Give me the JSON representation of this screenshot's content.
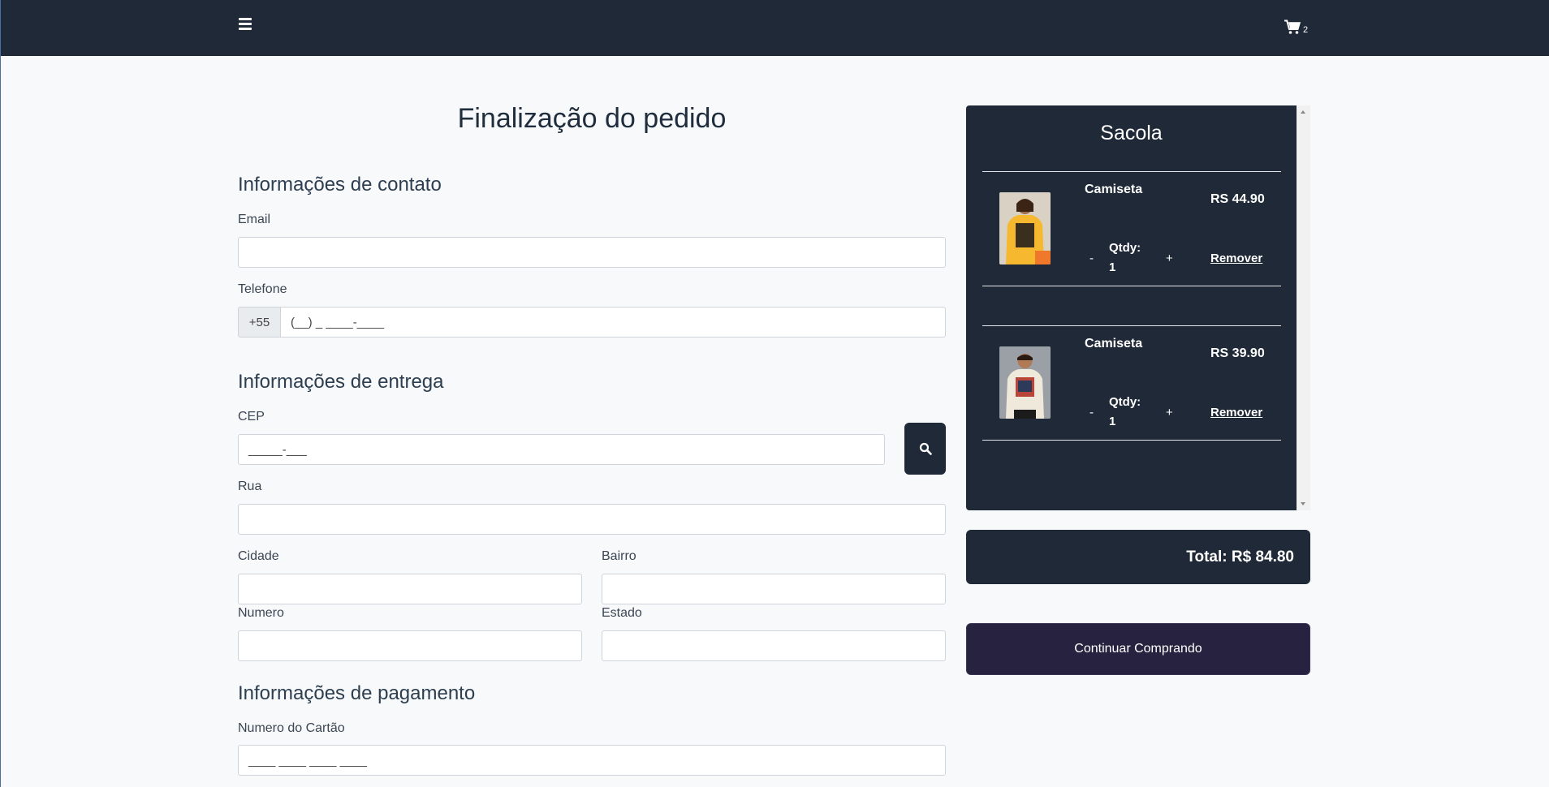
{
  "header": {
    "menu_icon": "hamburger-icon",
    "cart_icon": "cart-icon",
    "cart_count": "2"
  },
  "page": {
    "title": "Finalização do pedido"
  },
  "contact": {
    "title": "Informações de contato",
    "email_label": "Email",
    "email_value": "",
    "phone_label": "Telefone",
    "phone_prefix": "+55",
    "phone_mask": "(__) _ ____-____"
  },
  "delivery": {
    "title": "Informações de entrega",
    "cep_label": "CEP",
    "cep_mask": "_____-___",
    "search_icon": "search-icon",
    "street_label": "Rua",
    "city_label": "Cidade",
    "district_label": "Bairro",
    "number_label": "Numero",
    "state_label": "Estado"
  },
  "payment": {
    "title": "Informações de pagamento",
    "card_label": "Numero do Cartão",
    "card_mask": "____ ____ ____ ____"
  },
  "bag": {
    "title": "Sacola",
    "items": [
      {
        "name": "Camiseta",
        "price": "RS 44.90",
        "minus": "-",
        "plus": "+",
        "qty": "Qtdy: 1",
        "remove": "Remover",
        "shirt_color": "#f5b82e"
      },
      {
        "name": "Camiseta",
        "price": "RS 39.90",
        "minus": "-",
        "plus": "+",
        "qty": "Qtdy: 1",
        "remove": "Remover",
        "shirt_color": "#efe9dc"
      }
    ],
    "total": "Total: R$ 84.80",
    "continue_label": "Continuar Comprando"
  },
  "colors": {
    "navbar": "#1f2937",
    "accent_button": "#27223f"
  }
}
